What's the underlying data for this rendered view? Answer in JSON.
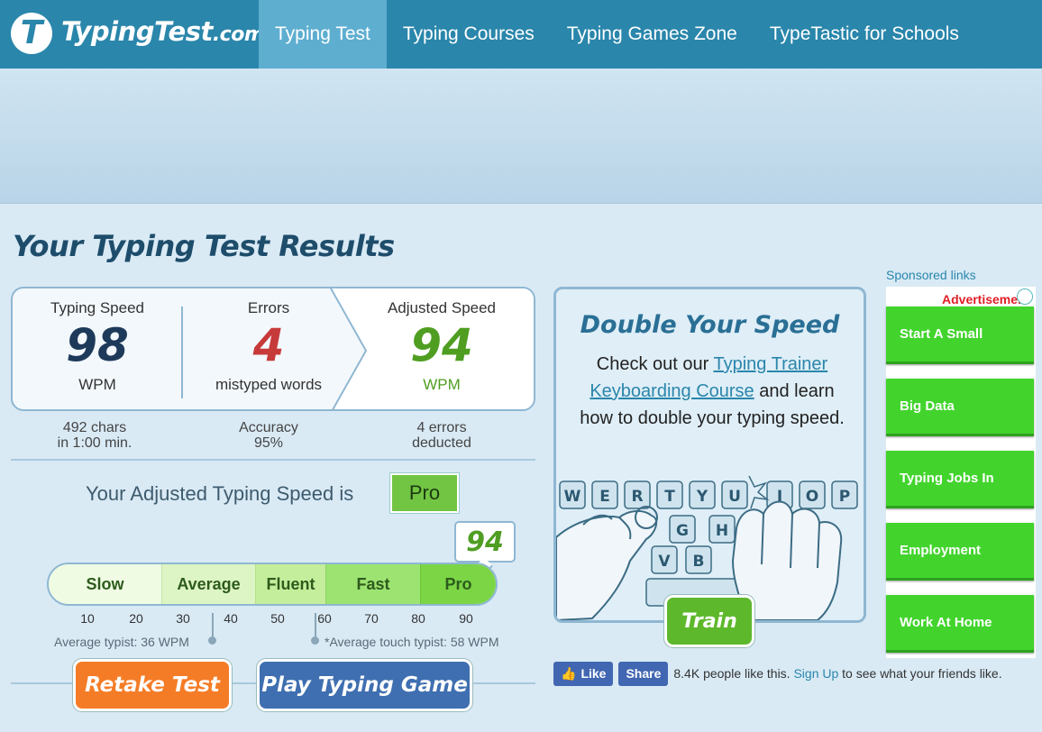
{
  "header": {
    "logo_icon": "T",
    "logo_text": "TypingTest",
    "logo_suffix": ".com",
    "nav": [
      {
        "label": "Typing Test",
        "active": true
      },
      {
        "label": "Typing Courses"
      },
      {
        "label": "Typing Games Zone"
      },
      {
        "label": "TypeTastic for Schools"
      }
    ]
  },
  "results": {
    "title": "Your Typing Test Results",
    "typing_speed": {
      "label": "Typing Speed",
      "value": "98",
      "unit": "WPM"
    },
    "errors": {
      "label": "Errors",
      "value": "4",
      "unit": "mistyped words"
    },
    "adjusted_speed": {
      "label": "Adjusted Speed",
      "value": "94",
      "unit": "WPM"
    },
    "sub": {
      "chars_line1": "492 chars",
      "chars_line2": "in 1:00 min.",
      "accuracy_line1": "Accuracy",
      "accuracy_line2": "95%",
      "deducted_line1": "4 errors",
      "deducted_line2": "deducted"
    },
    "statement": "Your Adjusted Typing Speed is",
    "level": "Pro"
  },
  "scale": {
    "segments": [
      "Slow",
      "Average",
      "Fluent",
      "Fast",
      "Pro"
    ],
    "ticks": [
      "10",
      "20",
      "30",
      "40",
      "50",
      "60",
      "70",
      "80",
      "90"
    ],
    "score": "94",
    "average_typist": "Average typist: 36 WPM",
    "average_touch_typist": "*Average touch typist: 58 WPM"
  },
  "buttons": {
    "retake": "Retake Test",
    "play_game": "Play Typing Game"
  },
  "promo": {
    "title": "Double Your Speed",
    "text_before": "Check out our ",
    "link": "Typing Trainer Keyboarding Course",
    "text_after": " and learn how to double your typing speed.",
    "keys_row1": [
      "W",
      "E",
      "R",
      "T",
      "Y",
      "U",
      "I",
      "O",
      "P"
    ],
    "keys_row2": [
      "G",
      "H"
    ],
    "keys_row3": [
      "V",
      "B"
    ],
    "train_button": "Train"
  },
  "facebook": {
    "like": "Like",
    "share": "Share",
    "count_text": "8.4K people like this.",
    "signup": "Sign Up",
    "after_signup": "to see what your friends like."
  },
  "sponsored": {
    "label": "Sponsored links",
    "ad_mark": "Advertisement",
    "links": [
      "Start A Small",
      "Big Data",
      "Typing Jobs In",
      "Employment",
      "Work At Home"
    ]
  },
  "colors": {
    "header_bg": "#2a86ab",
    "nav_active": "#5eaed0",
    "typing_speed": "#1e3a5a",
    "errors": "#c73a3a",
    "adjusted": "#4f9e22",
    "retake": "#f57c26",
    "play_game": "#3f6fb0",
    "train": "#5eb82b",
    "ad_green": "#42d42d"
  }
}
